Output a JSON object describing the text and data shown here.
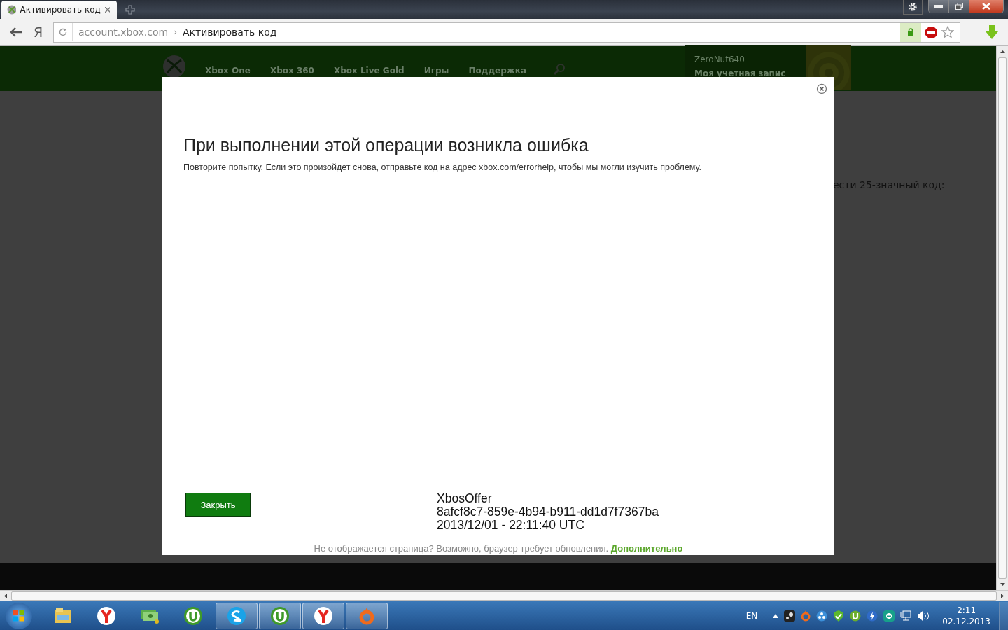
{
  "browser": {
    "tabs": [
      {
        "title": "Активировать код",
        "selected": true
      }
    ],
    "address": {
      "domain": "account.xbox.com",
      "separator": "›",
      "page_title": "Активировать код"
    },
    "yandex_button": "Я"
  },
  "site": {
    "nav": [
      "Xbox One",
      "Xbox 360",
      "Xbox Live Gold",
      "Игры",
      "Поддержка"
    ],
    "account": {
      "username": "ZeroNut640",
      "link": "Моя учетная запис"
    },
    "background_text": "ести 25-значный код:"
  },
  "dialog": {
    "title": "При выполнении этой операции возникла ошибка",
    "message": "Повторите попытку. Если это произойдет снова, отправьте код на адрес xbox.com/errorhelp, чтобы мы могли изучить проблему.",
    "close_button": "Закрыть",
    "details": [
      "XbosOffer",
      "8afcf8c7-859e-4b94-b911-dd1d7f7367ba",
      "2013/12/01 - 22:11:40 UTC"
    ],
    "footer_note": "Не отображается страница? Возможно, браузер требует обновления.",
    "footer_link": "Дополнительно"
  },
  "taskbar": {
    "apps": [
      {
        "kind": "folder",
        "running": false
      },
      {
        "kind": "yandex",
        "running": false
      },
      {
        "kind": "money",
        "running": false
      },
      {
        "kind": "torrent",
        "running": false
      },
      {
        "kind": "skype",
        "running": true
      },
      {
        "kind": "torrent",
        "running": true
      },
      {
        "kind": "yandex",
        "running": true
      },
      {
        "kind": "origin",
        "running": true
      }
    ],
    "language": "EN",
    "time": "2:11",
    "date": "02.12.2013"
  }
}
